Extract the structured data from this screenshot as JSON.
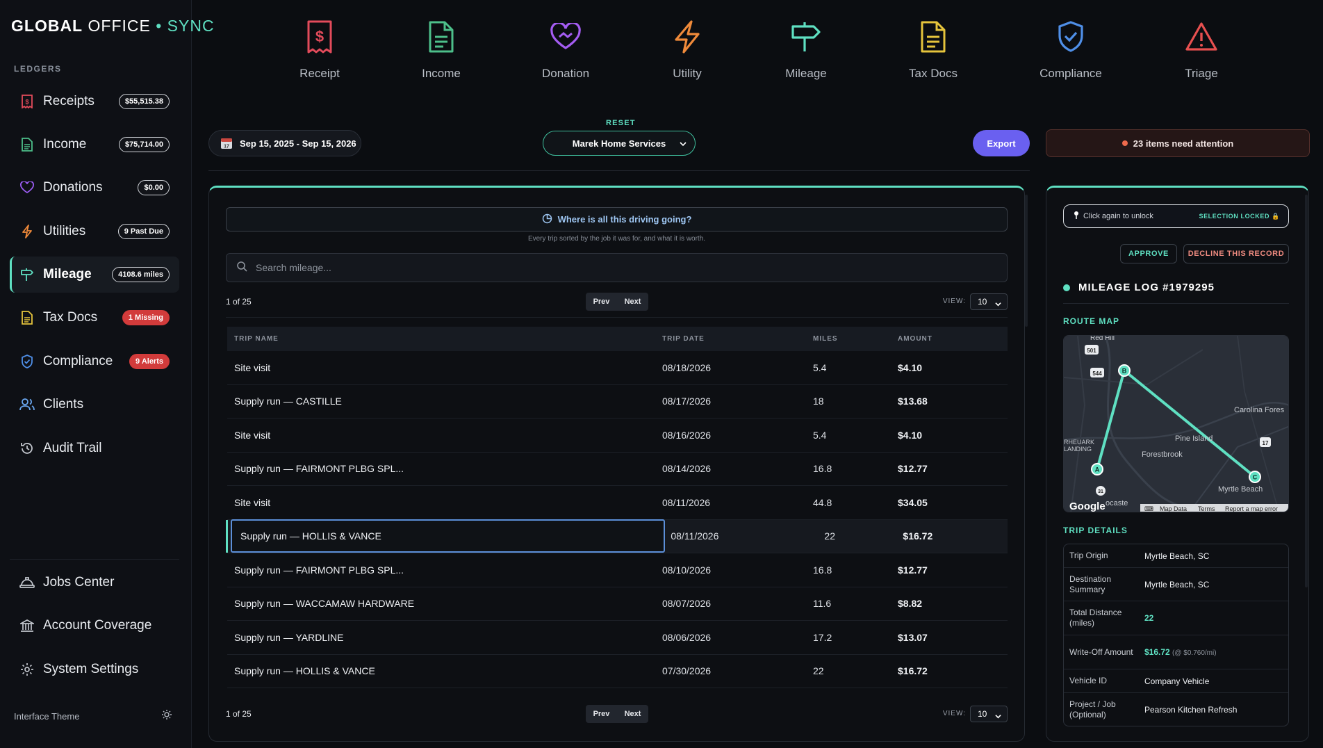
{
  "brand": {
    "part1": "GLOBAL",
    "part2": " OFFICE",
    "part3": " • SYNC"
  },
  "sidebar": {
    "section_label": "LEDGERS",
    "items": [
      {
        "label": "Receipts",
        "badge": "$55,515.38",
        "icon": "receipt-icon",
        "color": "#e34b5b"
      },
      {
        "label": "Income",
        "badge": "$75,714.00",
        "icon": "document-icon",
        "color": "#4dbf8a"
      },
      {
        "label": "Donations",
        "badge": "$0.00",
        "icon": "heart-icon",
        "color": "#9b5cf2"
      },
      {
        "label": "Utilities",
        "badge": "9 Past Due",
        "icon": "bolt-icon",
        "color": "#f08a3a"
      },
      {
        "label": "Mileage",
        "badge": "4108.6 miles",
        "icon": "signpost-icon",
        "color": "#5fe0c2"
      },
      {
        "label": "Tax Docs",
        "badge": "1 Missing",
        "icon": "file-icon",
        "color": "#e6c43c"
      },
      {
        "label": "Compliance",
        "badge": "9 Alerts",
        "icon": "shield-icon",
        "color": "#4f8fe8"
      },
      {
        "label": "Clients",
        "icon": "users-icon",
        "color": "#6aa7f0"
      },
      {
        "label": "Audit Trail",
        "icon": "history-icon",
        "color": "#c0c4cb"
      }
    ],
    "bottom_items": [
      {
        "label": "Jobs Center",
        "icon": "hardhat-icon"
      },
      {
        "label": "Account Coverage",
        "icon": "bank-icon"
      },
      {
        "label": "System Settings",
        "icon": "gear-icon"
      }
    ],
    "theme_label": "Interface Theme"
  },
  "categories": [
    {
      "label": "Receipt",
      "icon": "receipt-icon",
      "color": "#e34b5b"
    },
    {
      "label": "Income",
      "icon": "document-icon",
      "color": "#4dbf8a"
    },
    {
      "label": "Donation",
      "icon": "heart-icon",
      "color": "#a45cf2"
    },
    {
      "label": "Utility",
      "icon": "bolt-icon",
      "color": "#f08a3a"
    },
    {
      "label": "Mileage",
      "icon": "signpost-icon",
      "color": "#5fe0c2"
    },
    {
      "label": "Tax Docs",
      "icon": "file-icon",
      "color": "#e6c43c"
    },
    {
      "label": "Compliance",
      "icon": "shield-icon",
      "color": "#4f8fe8"
    },
    {
      "label": "Triage",
      "icon": "warning-icon",
      "color": "#e85050"
    }
  ],
  "toolbar": {
    "date_range": "Sep 15, 2025 - Sep 15, 2026",
    "reset_label": "RESET",
    "client": "Marek Home Services",
    "export_label": "Export",
    "attention": "23 items need attention"
  },
  "mileage": {
    "insight_label": "Where is all this driving going?",
    "insight_sub": "Every trip sorted by the job it was for, and what it is worth.",
    "search_placeholder": "Search mileage...",
    "page_count": "1 of 25",
    "prev_label": "Prev",
    "next_label": "Next",
    "view_label": "VIEW:",
    "view_value": "10",
    "columns": [
      "TRIP NAME",
      "TRIP DATE",
      "MILES",
      "AMOUNT"
    ],
    "rows": [
      {
        "name": "Site visit",
        "date": "08/18/2026",
        "miles": "5.4",
        "amount": "$4.10"
      },
      {
        "name": "Supply run — CASTILLE",
        "date": "08/17/2026",
        "miles": "18",
        "amount": "$13.68"
      },
      {
        "name": "Site visit",
        "date": "08/16/2026",
        "miles": "5.4",
        "amount": "$4.10"
      },
      {
        "name": "Supply run — FAIRMONT PLBG SPL...",
        "date": "08/14/2026",
        "miles": "16.8",
        "amount": "$12.77"
      },
      {
        "name": "Site visit",
        "date": "08/11/2026",
        "miles": "44.8",
        "amount": "$34.05"
      },
      {
        "name": "Supply run — HOLLIS & VANCE",
        "date": "08/11/2026",
        "miles": "22",
        "amount": "$16.72"
      },
      {
        "name": "Supply run — FAIRMONT PLBG SPL...",
        "date": "08/10/2026",
        "miles": "16.8",
        "amount": "$12.77"
      },
      {
        "name": "Supply run — WACCAMAW HARDWARE",
        "date": "08/07/2026",
        "miles": "11.6",
        "amount": "$8.82"
      },
      {
        "name": "Supply run — YARDLINE",
        "date": "08/06/2026",
        "miles": "17.2",
        "amount": "$13.07"
      },
      {
        "name": "Supply run — HOLLIS & VANCE",
        "date": "07/30/2026",
        "miles": "22",
        "amount": "$16.72"
      }
    ],
    "selected_row": 5
  },
  "detail": {
    "lock_hint": "Click again to unlock",
    "lock_status": "SELECTION LOCKED",
    "approve_label": "APPROVE",
    "decline_label": "DECLINE THIS RECORD",
    "title": "MILEAGE LOG #1979295",
    "route_label": "ROUTE MAP",
    "map": {
      "places": [
        "Red Hill",
        "Carolina Fores",
        "Pine Island",
        "Forestbrook",
        "RHEUARK",
        "LANDING",
        "Myrtle Beach",
        "ocaste"
      ],
      "route_markers": [
        "A",
        "B",
        "C"
      ],
      "shields": [
        "501",
        "544",
        "17",
        "31"
      ],
      "google": "Google",
      "attribution": [
        "Map Data",
        "Terms",
        "Report a map error"
      ]
    },
    "trip_label": "TRIP DETAILS",
    "fields": [
      {
        "key": "Trip Origin",
        "value": "Myrtle Beach, SC"
      },
      {
        "key": "Destination Summary",
        "value": "Myrtle Beach, SC"
      },
      {
        "key": "Total Distance (miles)",
        "value": "22"
      },
      {
        "key": "Write-Off Amount",
        "value": "$16.72",
        "note": "(@ $0.760/mi)"
      },
      {
        "key": "Vehicle ID",
        "value": "Company Vehicle"
      },
      {
        "key": "Project / Job (Optional)",
        "value": "Pearson Kitchen Refresh"
      }
    ]
  }
}
